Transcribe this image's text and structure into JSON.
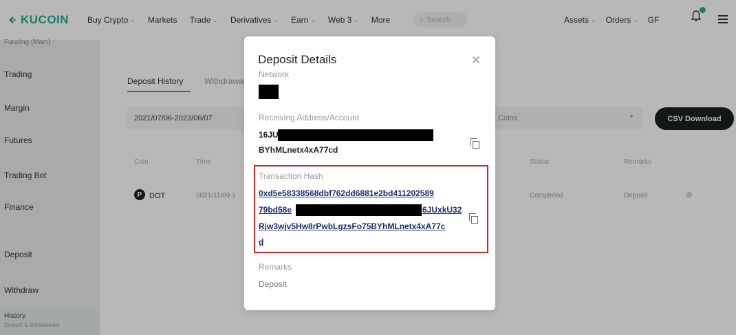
{
  "brand": {
    "name": "KUCOIN",
    "color": "#23af91"
  },
  "nav": {
    "items": [
      {
        "label": "Buy Crypto",
        "caret": true
      },
      {
        "label": "Markets",
        "caret": false
      },
      {
        "label": "Trade",
        "caret": true
      },
      {
        "label": "Derivatives",
        "caret": true
      },
      {
        "label": "Earn",
        "caret": true
      },
      {
        "label": "Web 3",
        "caret": true
      },
      {
        "label": "More",
        "caret": false
      }
    ],
    "search_placeholder": "Search",
    "right_items": [
      {
        "label": "Assets",
        "caret": true
      },
      {
        "label": "Orders",
        "caret": true
      },
      {
        "label": "GF",
        "caret": false
      }
    ],
    "bell_icon": "bell-icon",
    "menu_icon": "hamburger-icon"
  },
  "sidebar": {
    "top_partial": "Funding (Main)",
    "items": [
      "Trading",
      "Margin",
      "Futures",
      "Trading Bot",
      "Finance",
      "Deposit",
      "Withdraw"
    ],
    "active": {
      "label": "History",
      "sub": "Deposit & Withdrawals"
    }
  },
  "main": {
    "tabs": [
      "Deposit History",
      "Withdrawal"
    ],
    "date_range": "2021/07/06-2023/06/07",
    "coins_placeholder": "Coins",
    "csv_button": "CSV Download",
    "columns": [
      "Coin",
      "Time",
      "Status",
      "Remarks"
    ],
    "row": {
      "coin": "DOT",
      "time": "2021/11/09 1",
      "status": "Completed",
      "remarks": "Deposit"
    }
  },
  "modal": {
    "title": "Deposit Details",
    "network_label": "Network",
    "address_label": "Receiving Address/Account",
    "address_prefix": "16JU",
    "address_suffix": "BYhMLnetx4xA77cd",
    "hash_label": "Transaction Hash",
    "hash_line1": "0xd5e58338568dbf762dd6881e2bd411202589",
    "hash_line2_prefix": "79bd58e",
    "hash_line2_suffix": "6JUxkU32",
    "hash_line3": "Rjw3wjv5Hw8rPwbLgzsFo75BYhMLnetx4xA77c",
    "hash_line4": "d",
    "remarks_label": "Remarks",
    "remarks_value": "Deposit",
    "highlight_color": "#e11d1d"
  }
}
